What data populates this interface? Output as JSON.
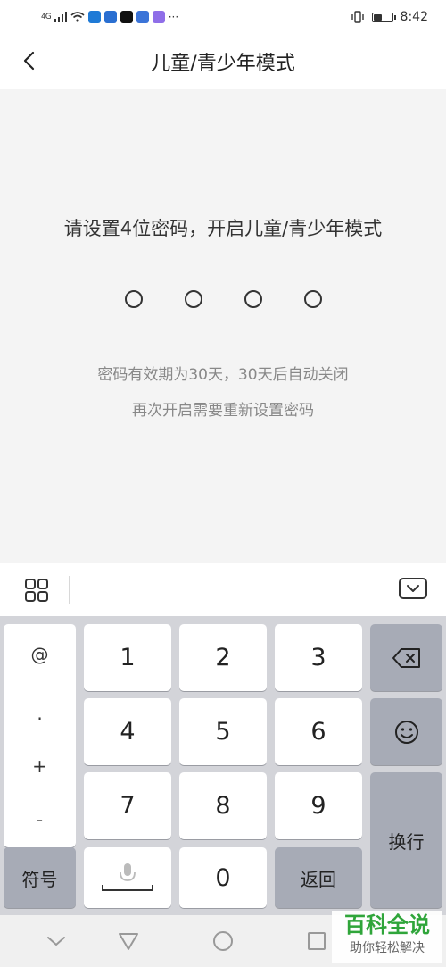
{
  "status_bar": {
    "network_label": "4G",
    "more_indicator": "···",
    "time": "8:42",
    "battery_level": 0.45
  },
  "header": {
    "title": "儿童/青少年模式"
  },
  "content": {
    "prompt": "请设置4位密码，开启儿童/青少年模式",
    "pin_length": 4,
    "note_line1": "密码有效期为30天，30天后自动关闭",
    "note_line2": "再次开启需要重新设置密码"
  },
  "keyboard": {
    "symbols": [
      "@",
      ".",
      "+",
      "-"
    ],
    "digits": [
      "1",
      "2",
      "3",
      "4",
      "5",
      "6",
      "7",
      "8",
      "9",
      "0"
    ],
    "symbols_key": "符号",
    "return_key": "返回",
    "enter_key": "换行"
  },
  "watermark": {
    "main": "百科全说",
    "sub": "助你轻松解决"
  },
  "colors": {
    "watermark_green": "#2fa53a",
    "keyboard_bg": "#d3d4d9",
    "function_key": "#a7abb6"
  }
}
